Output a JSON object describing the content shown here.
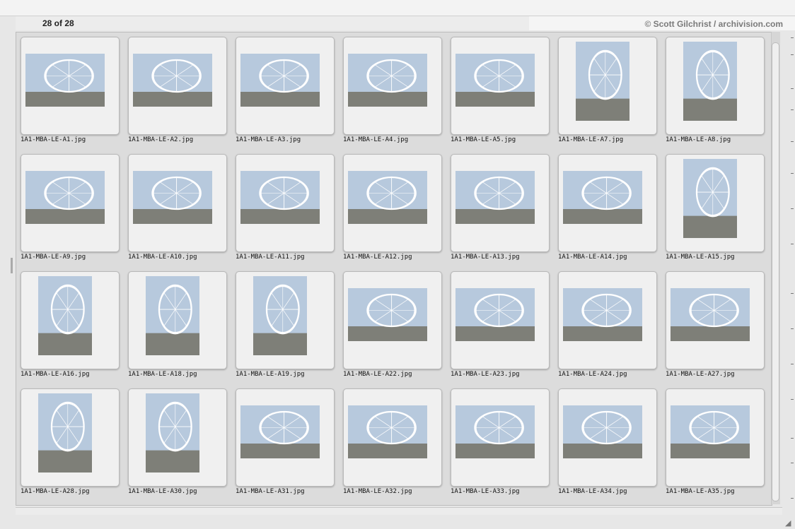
{
  "header": {
    "count_text": "28 of 28",
    "credit": "© Scott Gilchrist / archivision.com"
  },
  "colors": {
    "panel": "#dcdcdc",
    "frame": "#f0f0f0",
    "thumb_sky": "#b7c9dd",
    "wheel": "#ffffff",
    "water": "#7e7f78"
  },
  "thumbnails": [
    {
      "file": "1A1-MBA-LE-A1.jpg",
      "orientation": "landscape"
    },
    {
      "file": "1A1-MBA-LE-A2.jpg",
      "orientation": "landscape"
    },
    {
      "file": "1A1-MBA-LE-A3.jpg",
      "orientation": "landscape"
    },
    {
      "file": "1A1-MBA-LE-A4.jpg",
      "orientation": "landscape"
    },
    {
      "file": "1A1-MBA-LE-A5.jpg",
      "orientation": "landscape"
    },
    {
      "file": "1A1-MBA-LE-A7.jpg",
      "orientation": "portrait"
    },
    {
      "file": "1A1-MBA-LE-A8.jpg",
      "orientation": "portrait"
    },
    {
      "file": "1A1-MBA-LE-A9.jpg",
      "orientation": "landscape"
    },
    {
      "file": "1A1-MBA-LE-A10.jpg",
      "orientation": "landscape"
    },
    {
      "file": "1A1-MBA-LE-A11.jpg",
      "orientation": "landscape"
    },
    {
      "file": "1A1-MBA-LE-A12.jpg",
      "orientation": "landscape"
    },
    {
      "file": "1A1-MBA-LE-A13.jpg",
      "orientation": "landscape"
    },
    {
      "file": "1A1-MBA-LE-A14.jpg",
      "orientation": "landscape"
    },
    {
      "file": "1A1-MBA-LE-A15.jpg",
      "orientation": "portrait"
    },
    {
      "file": "1A1-MBA-LE-A16.jpg",
      "orientation": "portrait"
    },
    {
      "file": "1A1-MBA-LE-A18.jpg",
      "orientation": "portrait"
    },
    {
      "file": "1A1-MBA-LE-A19.jpg",
      "orientation": "portrait"
    },
    {
      "file": "1A1-MBA-LE-A22.jpg",
      "orientation": "landscape"
    },
    {
      "file": "1A1-MBA-LE-A23.jpg",
      "orientation": "landscape"
    },
    {
      "file": "1A1-MBA-LE-A24.jpg",
      "orientation": "landscape"
    },
    {
      "file": "1A1-MBA-LE-A27.jpg",
      "orientation": "landscape"
    },
    {
      "file": "1A1-MBA-LE-A28.jpg",
      "orientation": "portrait"
    },
    {
      "file": "1A1-MBA-LE-A30.jpg",
      "orientation": "portrait"
    },
    {
      "file": "1A1-MBA-LE-A31.jpg",
      "orientation": "landscape"
    },
    {
      "file": "1A1-MBA-LE-A32.jpg",
      "orientation": "landscape"
    },
    {
      "file": "1A1-MBA-LE-A33.jpg",
      "orientation": "landscape"
    },
    {
      "file": "1A1-MBA-LE-A34.jpg",
      "orientation": "landscape"
    },
    {
      "file": "1A1-MBA-LE-A35.jpg",
      "orientation": "landscape"
    }
  ]
}
